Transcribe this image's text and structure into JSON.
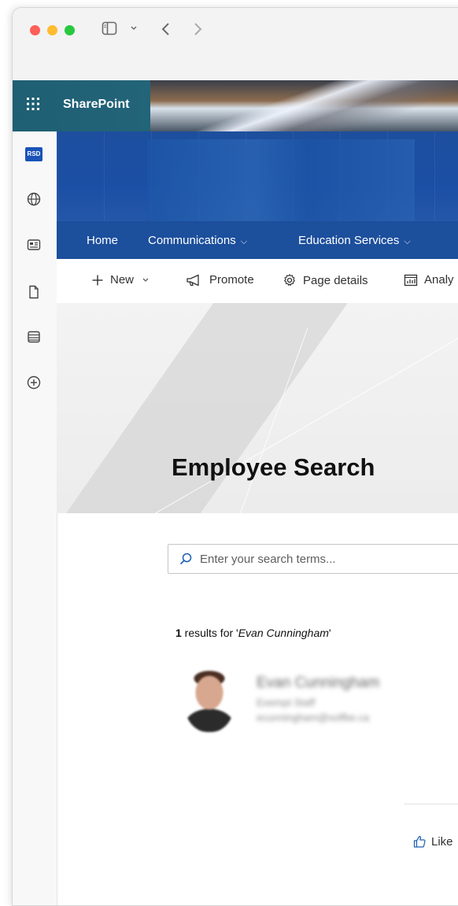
{
  "browser": {
    "icons": [
      "sidebar-icon",
      "chevron-down-icon",
      "back-icon",
      "forward-icon"
    ]
  },
  "suite_bar": {
    "app_name": "SharePoint"
  },
  "left_rail": {
    "badge": "RSD",
    "icons": [
      "globe-icon",
      "news-icon",
      "document-icon",
      "list-icon",
      "add-icon"
    ]
  },
  "nav": {
    "items": [
      {
        "label": "Home"
      },
      {
        "label": "Communications"
      },
      {
        "label": "Education Services"
      }
    ]
  },
  "command_bar": {
    "new_label": "New",
    "promote_label": "Promote",
    "page_details_label": "Page details",
    "analytics_label": "Analy"
  },
  "page": {
    "title": "Employee Search"
  },
  "search": {
    "placeholder": "Enter your search terms..."
  },
  "results": {
    "count": "1",
    "text_prefix": " results for '",
    "query": "Evan Cunningham",
    "text_suffix": "'"
  },
  "person": {
    "name": "Evan Cunningham",
    "title": "Exempt Staff",
    "email": "ecunningham@solfbe.ca"
  },
  "footer": {
    "like_label": "Like"
  },
  "colors": {
    "suite_bar": "#1f5f73",
    "nav_bar": "#1c4f9c",
    "hero": "#1d4f9e",
    "badge": "#1a53b8"
  }
}
